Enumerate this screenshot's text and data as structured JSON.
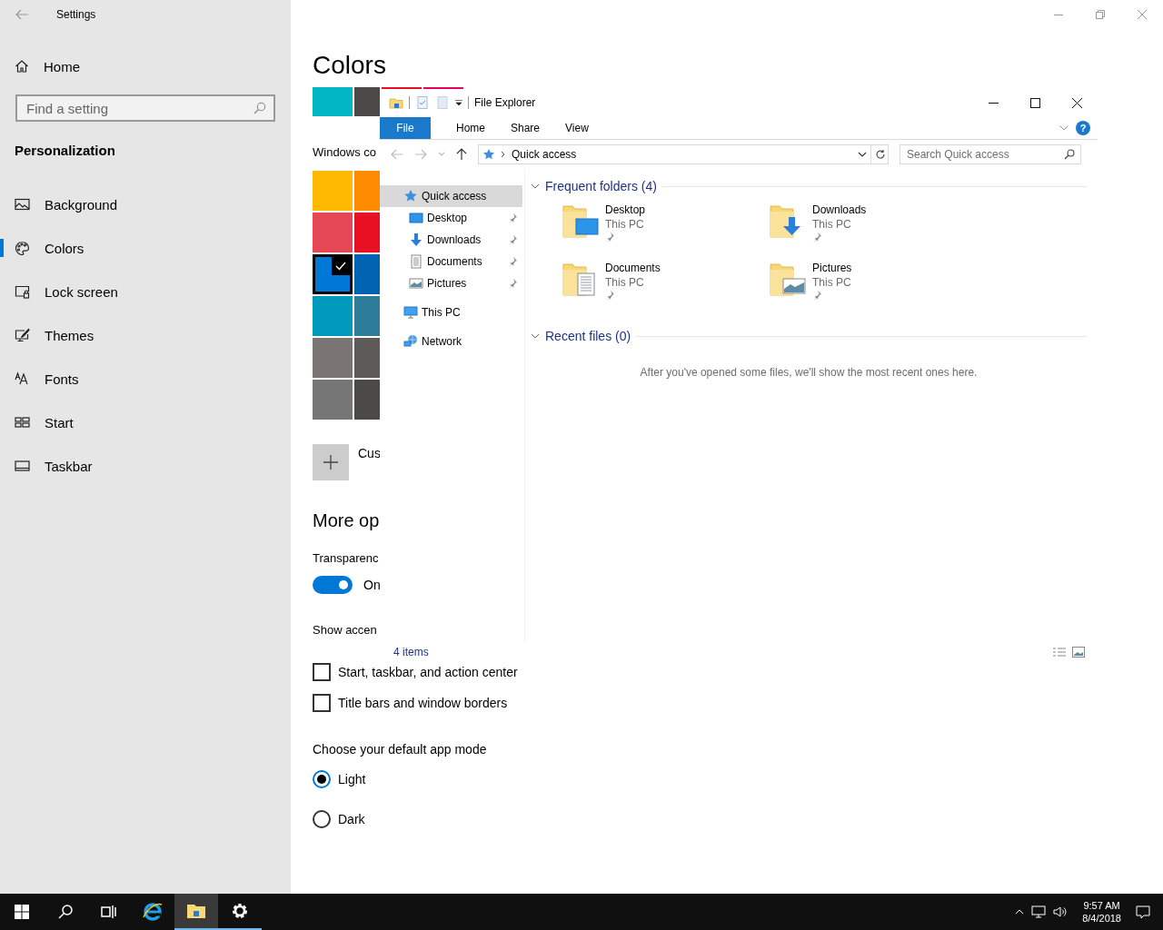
{
  "settings": {
    "title": "Settings",
    "sidebar": {
      "home": "Home",
      "search": {
        "placeholder": "Find a setting"
      },
      "section": "Personalization",
      "items": [
        {
          "label": "Background",
          "selected": false
        },
        {
          "label": "Colors",
          "selected": true
        },
        {
          "label": "Lock screen",
          "selected": false
        },
        {
          "label": "Themes",
          "selected": false
        },
        {
          "label": "Fonts",
          "selected": false
        },
        {
          "label": "Start",
          "selected": false
        },
        {
          "label": "Taskbar",
          "selected": false
        }
      ]
    },
    "page": {
      "title": "Colors",
      "recent_colors": [
        {
          "color": "#00b7c3"
        },
        {
          "color": "#4c4a48"
        },
        {
          "color": "#e81123"
        },
        {
          "color": "#ea005e"
        }
      ],
      "windows_colors_label": "Windows co",
      "accent_colors": [
        {
          "color": "#ffb900",
          "selected": false
        },
        {
          "color": "#ff8c00",
          "selected": false
        },
        {
          "color": "#e74856",
          "selected": false
        },
        {
          "color": "#e81123",
          "selected": false
        },
        {
          "color": "#0078d7",
          "selected": true
        },
        {
          "color": "#0063b1",
          "selected": false
        },
        {
          "color": "#0099bc",
          "selected": false
        },
        {
          "color": "#2d7d9a",
          "selected": false
        },
        {
          "color": "#7a7574",
          "selected": false
        },
        {
          "color": "#5d5a58",
          "selected": false
        },
        {
          "color": "#767676",
          "selected": false
        },
        {
          "color": "#4c4a48",
          "selected": false
        }
      ],
      "custom_color": "Cus",
      "more_options_heading": "More op",
      "transparency": {
        "label": "Transparenc",
        "on": true,
        "state_text": "On"
      },
      "show_accent_label": "Show accen",
      "accent_surfaces": [
        {
          "label": "Start, taskbar, and action center",
          "checked": false
        },
        {
          "label": "Title bars and window borders",
          "checked": false
        }
      ],
      "app_mode": {
        "label": "Choose your default app mode",
        "options": [
          {
            "label": "Light",
            "selected": true
          },
          {
            "label": "Dark",
            "selected": false
          }
        ]
      }
    }
  },
  "file_explorer": {
    "title": "File Explorer",
    "ribbon_tabs": [
      {
        "label": "File",
        "kind": "menu"
      },
      {
        "label": "Home",
        "kind": "tab"
      },
      {
        "label": "Share",
        "kind": "tab"
      },
      {
        "label": "View",
        "kind": "tab"
      }
    ],
    "help": "?",
    "address": "Quick access",
    "search": {
      "placeholder": "Search Quick access"
    },
    "nav": [
      {
        "label": "Quick access",
        "selected": true,
        "children": [
          {
            "label": "Desktop",
            "selected": false,
            "pinned": true
          },
          {
            "label": "Downloads",
            "selected": false,
            "pinned": true
          },
          {
            "label": "Documents",
            "selected": false,
            "pinned": true
          },
          {
            "label": "Pictures",
            "selected": false,
            "pinned": true
          }
        ]
      },
      {
        "label": "This PC",
        "selected": false
      },
      {
        "label": "Network",
        "selected": false
      }
    ],
    "sections": [
      {
        "title": "Frequent folders (4)",
        "expanded": true,
        "folders": [
          {
            "name": "Desktop",
            "location": "This PC",
            "pinned": true
          },
          {
            "name": "Downloads",
            "location": "This PC",
            "pinned": true
          },
          {
            "name": "Documents",
            "location": "This PC",
            "pinned": true
          },
          {
            "name": "Pictures",
            "location": "This PC",
            "pinned": true
          }
        ]
      },
      {
        "title": "Recent files (0)",
        "expanded": true,
        "empty_message": "After you've opened some files, we'll show the most recent ones here."
      }
    ],
    "status": "4 items"
  },
  "taskbar": {
    "apps": [
      {
        "running": false,
        "active": false
      },
      {
        "running": true,
        "active": true
      },
      {
        "running": true,
        "active": false
      }
    ],
    "clock": {
      "time": "9:57 AM",
      "date": "8/4/2018"
    }
  }
}
